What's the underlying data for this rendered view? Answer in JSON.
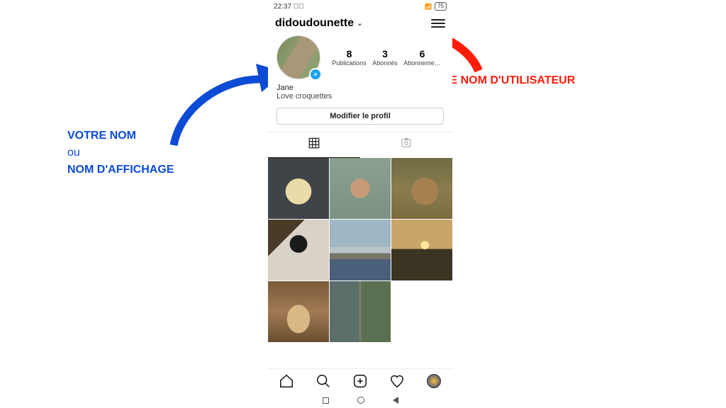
{
  "status": {
    "time": "22:37",
    "battery": "75"
  },
  "header": {
    "username": "didoudounette"
  },
  "stats": {
    "posts": {
      "count": "8",
      "label": "Publications"
    },
    "followers": {
      "count": "3",
      "label": "Abonnés"
    },
    "following": {
      "count": "6",
      "label": "Abonneme…"
    }
  },
  "bio": {
    "name": "Jane",
    "desc": "Love croquettes"
  },
  "buttons": {
    "edit": "Modifier le profil"
  },
  "annotations": {
    "username_label": "VOTRE NOM D'UTILISATEUR",
    "name_line1": "VOTRE NOM",
    "name_or": "ou",
    "name_line2": "NOM D'AFFICHAGE"
  }
}
